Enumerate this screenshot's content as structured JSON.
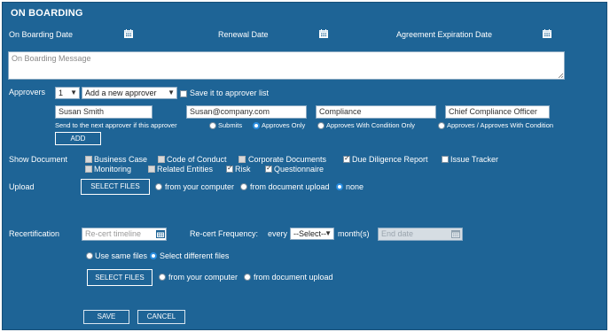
{
  "header": {
    "title": "ON BOARDING"
  },
  "dates": {
    "onboarding_label": "On Boarding Date",
    "renewal_label": "Renewal Date",
    "expiration_label": "Agreement Expiration Date"
  },
  "message": {
    "placeholder": "On Boarding Message"
  },
  "approvers": {
    "label": "Approvers",
    "count": "1",
    "add_select": "Add a new approver",
    "save_list_label": "Save it to approver list",
    "save_list_checked": false,
    "name": "Susan Smith",
    "email": "Susan@company.com",
    "department": "Compliance",
    "role": "Chief Compliance Officer",
    "send_next_label": "Send to the next approver if this approver",
    "options": [
      "Submits",
      "Approves Only",
      "Approves With Condition Only",
      "Approves / Approves With Condition"
    ],
    "selected_option": "Approves Only",
    "add_button": "ADD"
  },
  "show_document": {
    "label": "Show Document",
    "items": [
      {
        "label": "Business Case",
        "checked": false,
        "enabled": false
      },
      {
        "label": "Code of Conduct",
        "checked": false,
        "enabled": false
      },
      {
        "label": "Corporate Documents",
        "checked": false,
        "enabled": false
      },
      {
        "label": "Due Diligence Report",
        "checked": true,
        "enabled": true
      },
      {
        "label": "Issue Tracker",
        "checked": false,
        "enabled": true
      },
      {
        "label": "Monitoring",
        "checked": false,
        "enabled": false
      },
      {
        "label": "Related Entities",
        "checked": false,
        "enabled": false
      },
      {
        "label": "Risk",
        "checked": true,
        "enabled": true
      },
      {
        "label": "Questionnaire",
        "checked": true,
        "enabled": true
      }
    ]
  },
  "upload": {
    "label": "Upload",
    "button": "SELECT FILES",
    "options": [
      "from your computer",
      "from document upload",
      "none"
    ],
    "selected": "none"
  },
  "recert": {
    "label": "Recertification",
    "timeline_placeholder": "Re-cert timeline",
    "frequency_label": "Re-cert Frequency:",
    "every_label": "every",
    "frequency_select": "--Select--",
    "months_label": "month(s)",
    "end_date_placeholder": "End date",
    "file_options": [
      "Use same files",
      "Select different files"
    ],
    "file_selected": "Select different files",
    "button": "SELECT FILES",
    "source_options": [
      "from your computer",
      "from document upload"
    ],
    "source_selected": ""
  },
  "footer": {
    "save": "SAVE",
    "cancel": "CANCEL"
  },
  "colors": {
    "panel": "#1e6496",
    "radio_accent": "#2a8ee0"
  }
}
